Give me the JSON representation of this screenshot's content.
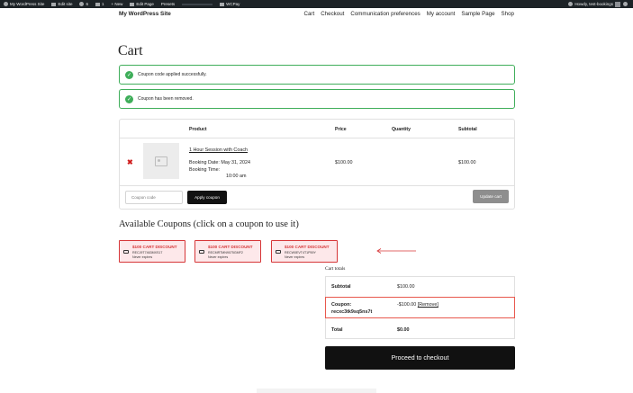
{
  "adminbar": {
    "site": "My WordPress Site",
    "edit_site": "Edit site",
    "updates": "6",
    "comments": "1",
    "new": "+ New",
    "edit_page": "Edit Page",
    "presets": "Presets",
    "wcpay": "WCPay",
    "howdy": "Howdy, test-bookings"
  },
  "header": {
    "site_title": "My WordPress Site",
    "nav": [
      "Cart",
      "Checkout",
      "Communication preferences",
      "My account",
      "Sample Page",
      "Shop"
    ]
  },
  "page": {
    "title": "Cart"
  },
  "notices": [
    "Coupon code applied successfully.",
    "Coupon has been removed."
  ],
  "cart": {
    "headers": {
      "product": "Product",
      "price": "Price",
      "quantity": "Quantity",
      "subtotal": "Subtotal"
    },
    "item": {
      "remove": "✖",
      "name": "1 Hour Session with Coach",
      "booking_date": "Booking Date: May 31, 2024",
      "booking_time_label": "Booking Time:",
      "booking_time_value": "10:00 am",
      "price": "$100.00",
      "subtotal": "$100.00"
    },
    "coupon_placeholder": "Coupon code",
    "apply_label": "Apply coupon",
    "update_label": "Update cart"
  },
  "available_coupons": {
    "title": "Available Coupons (click on a coupon to use it)",
    "items": [
      {
        "title": "$100 CART DISCOUNT",
        "code": "RECJ9T7463MXS17",
        "expiry": "Never expires"
      },
      {
        "title": "$100 CART DISCOUNT",
        "code": "RECMRTMN9075GMF2",
        "expiry": "Never expires"
      },
      {
        "title": "$100 CART DISCOUNT",
        "code": "RECW0EVT4T1P59Y",
        "expiry": "Never expires"
      }
    ]
  },
  "totals": {
    "title": "Cart totals",
    "subtotal_label": "Subtotal",
    "subtotal_value": "$100.00",
    "coupon_label": "Coupon:",
    "coupon_code": "recxc3tk9sq5ns7t",
    "coupon_value": "-$100.00",
    "coupon_remove": "[Remove]",
    "total_label": "Total",
    "total_value": "$0.00",
    "checkout_label": "Proceed to checkout"
  },
  "colors": {
    "notice_border": "#3fae5a",
    "coupon_red": "#d63638",
    "coupon_bg": "#fde8ea",
    "highlight_border": "#e8584d",
    "button_dark": "#111111"
  }
}
